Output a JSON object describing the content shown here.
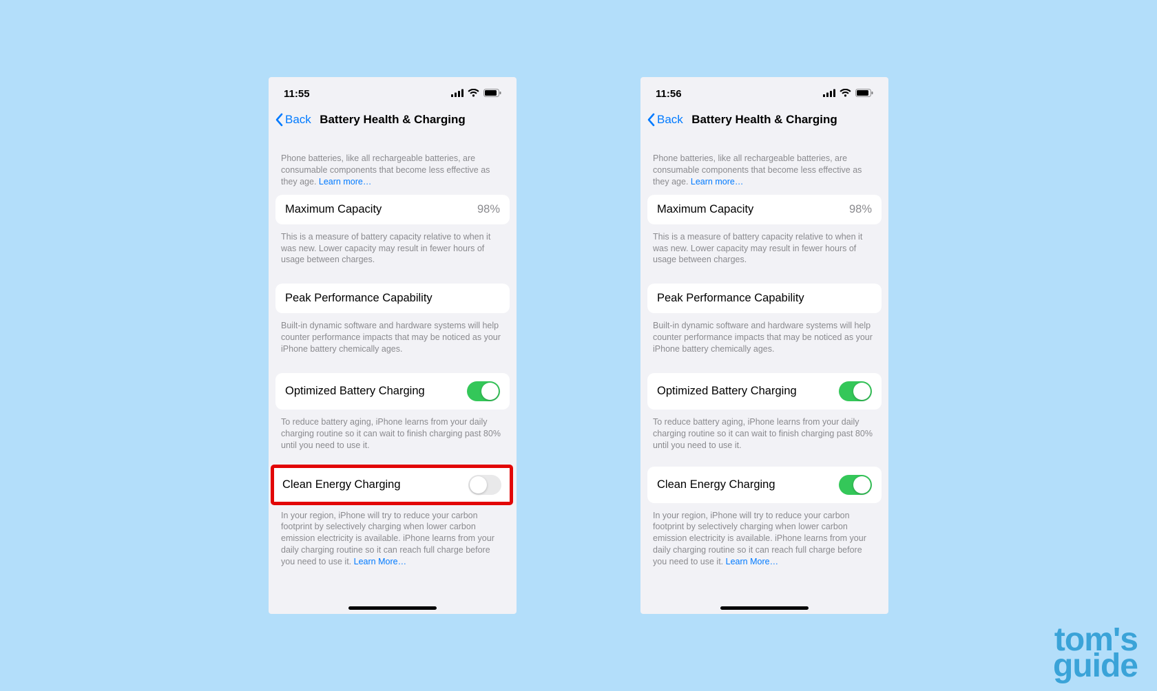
{
  "watermark": {
    "line1": "tom's",
    "line2": "guide"
  },
  "phones": [
    {
      "status": {
        "time": "11:55"
      },
      "nav": {
        "back": "Back",
        "title": "Battery Health & Charging"
      },
      "intro_text": "Phone batteries, like all rechargeable batteries, are consumable components that become less effective as they age. ",
      "intro_link": "Learn more…",
      "capacity": {
        "label": "Maximum Capacity",
        "value": "98%"
      },
      "capacity_footer": "This is a measure of battery capacity relative to when it was new. Lower capacity may result in fewer hours of usage between charges.",
      "peak": {
        "label": "Peak Performance Capability"
      },
      "peak_footer": "Built-in dynamic software and hardware systems will help counter performance impacts that may be noticed as your iPhone battery chemically ages.",
      "optimized": {
        "label": "Optimized Battery Charging",
        "on": true
      },
      "optimized_footer": "To reduce battery aging, iPhone learns from your daily charging routine so it can wait to finish charging past 80% until you need to use it.",
      "clean": {
        "label": "Clean Energy Charging",
        "on": false,
        "highlight": true
      },
      "clean_footer_text": "In your region, iPhone will try to reduce your carbon footprint by selectively charging when lower carbon emission electricity is available. iPhone learns from your daily charging routine so it can reach full charge before you need to use it. ",
      "clean_footer_link": "Learn More…"
    },
    {
      "status": {
        "time": "11:56"
      },
      "nav": {
        "back": "Back",
        "title": "Battery Health & Charging"
      },
      "intro_text": "Phone batteries, like all rechargeable batteries, are consumable components that become less effective as they age. ",
      "intro_link": "Learn more…",
      "capacity": {
        "label": "Maximum Capacity",
        "value": "98%"
      },
      "capacity_footer": "This is a measure of battery capacity relative to when it was new. Lower capacity may result in fewer hours of usage between charges.",
      "peak": {
        "label": "Peak Performance Capability"
      },
      "peak_footer": "Built-in dynamic software and hardware systems will help counter performance impacts that may be noticed as your iPhone battery chemically ages.",
      "optimized": {
        "label": "Optimized Battery Charging",
        "on": true
      },
      "optimized_footer": "To reduce battery aging, iPhone learns from your daily charging routine so it can wait to finish charging past 80% until you need to use it.",
      "clean": {
        "label": "Clean Energy Charging",
        "on": true,
        "highlight": false
      },
      "clean_footer_text": "In your region, iPhone will try to reduce your carbon footprint by selectively charging when lower carbon emission electricity is available. iPhone learns from your daily charging routine so it can reach full charge before you need to use it. ",
      "clean_footer_link": "Learn More…"
    }
  ]
}
